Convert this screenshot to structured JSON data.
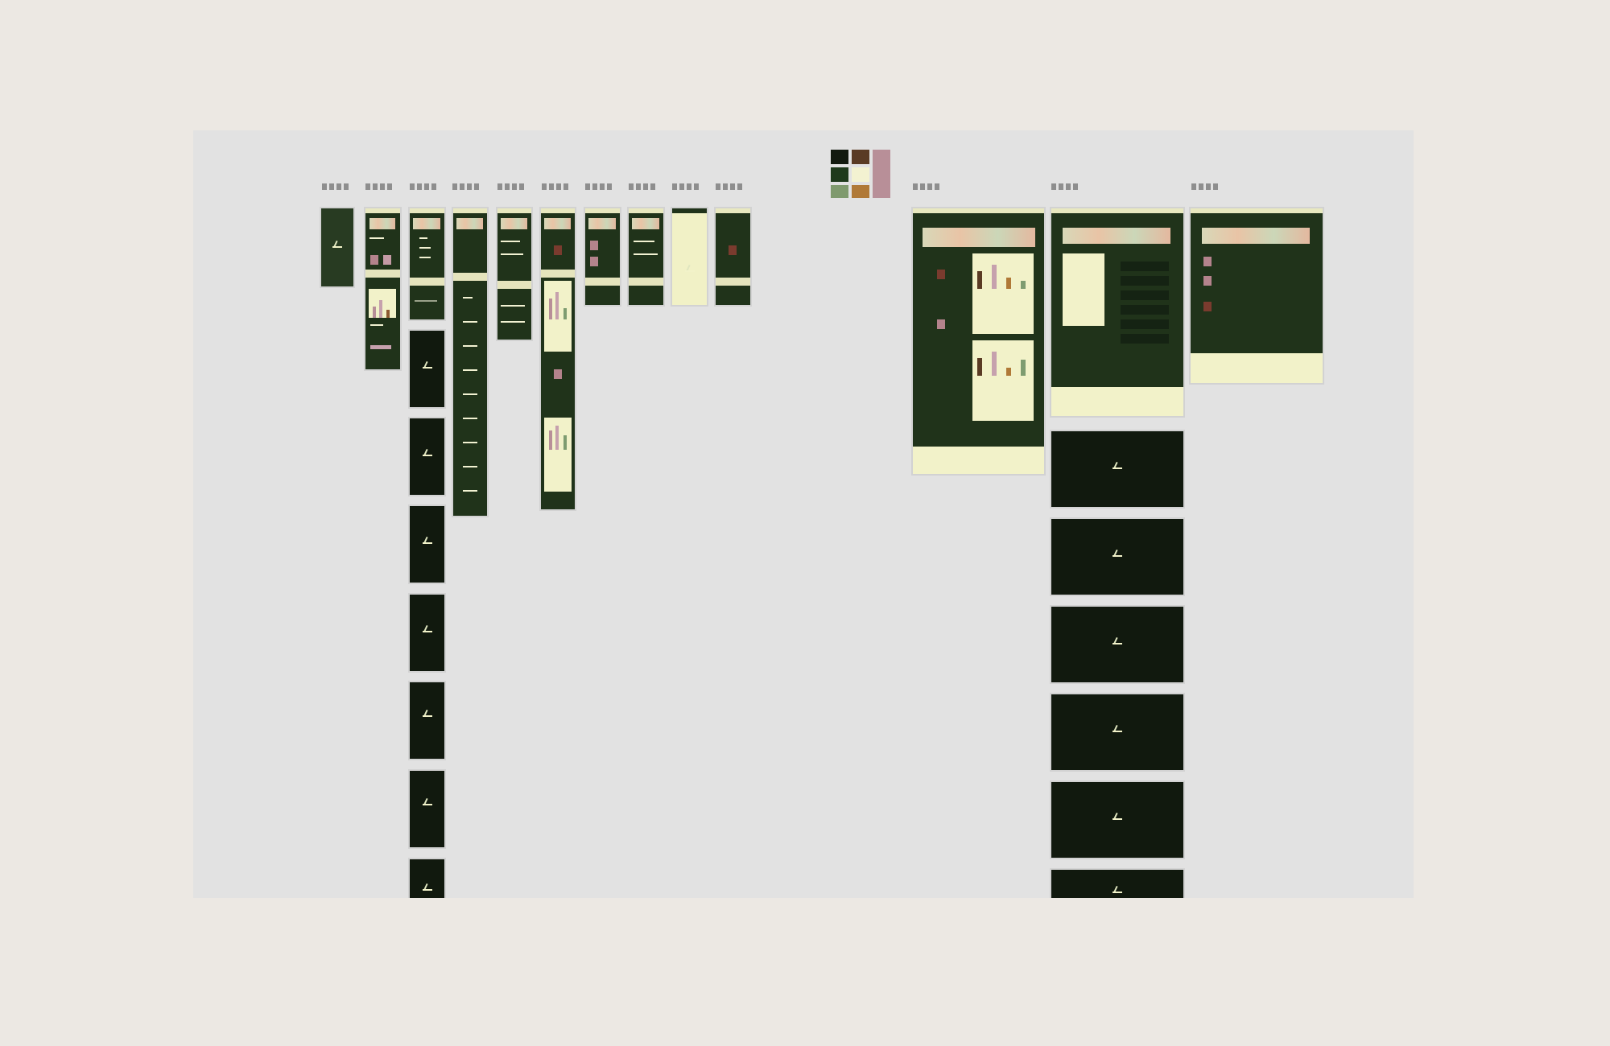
{
  "canvas": {
    "background": "#e2e2e2",
    "page_background": "#ece8e3"
  },
  "palette": {
    "colors": [
      "#121a0f",
      "#5a3b24",
      "#1f3a1c",
      "#f3f2d1",
      "#7f9a6e",
      "#b07937",
      "#b88f98"
    ]
  },
  "colors": {
    "frame_dark": "#11190e",
    "frame_green": "#20331a",
    "cream": "#f1f1c6",
    "accent_rose": "#c6a1ad",
    "accent_brown": "#8d5a32",
    "accent_green": "#7e9c70"
  },
  "frame_labels": [
    "",
    "",
    "",
    "",
    "",
    "",
    "",
    "",
    "",
    "",
    "",
    "",
    ""
  ],
  "icons": [
    "leaf-sprout-icon",
    "avatar-thumbnail-icon"
  ]
}
